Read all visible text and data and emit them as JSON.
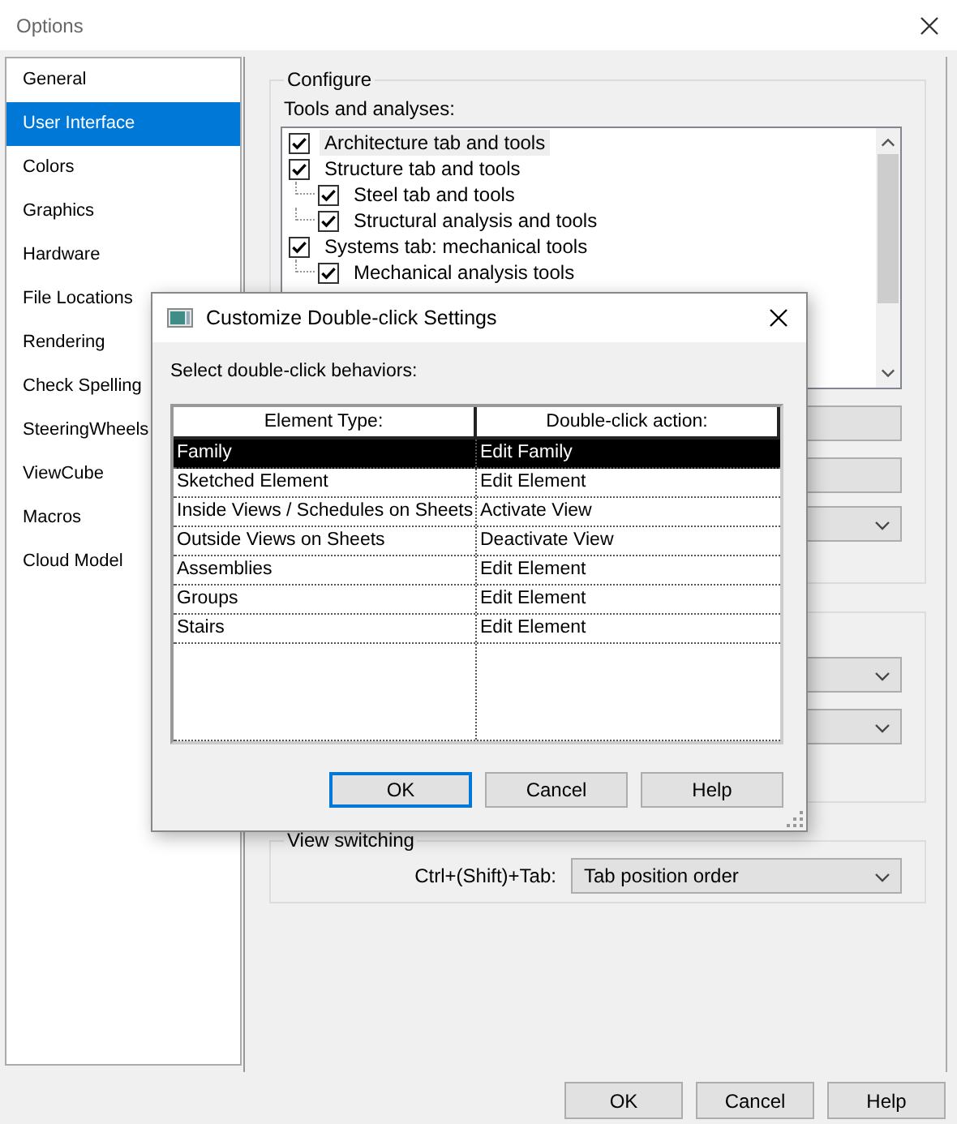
{
  "window": {
    "title": "Options"
  },
  "sidebar": {
    "items": [
      {
        "label": "General",
        "selected": false
      },
      {
        "label": "User Interface",
        "selected": true
      },
      {
        "label": "Colors",
        "selected": false
      },
      {
        "label": "Graphics",
        "selected": false
      },
      {
        "label": "Hardware",
        "selected": false
      },
      {
        "label": "File Locations",
        "selected": false
      },
      {
        "label": "Rendering",
        "selected": false
      },
      {
        "label": "Check Spelling",
        "selected": false
      },
      {
        "label": "SteeringWheels",
        "selected": false
      },
      {
        "label": "ViewCube",
        "selected": false
      },
      {
        "label": "Macros",
        "selected": false
      },
      {
        "label": "Cloud Model",
        "selected": false
      }
    ]
  },
  "configure": {
    "title": "Configure",
    "tools_label": "Tools and analyses:",
    "tools": [
      {
        "label": "Architecture tab and tools",
        "checked": true,
        "selected": true
      },
      {
        "label": "Structure tab and tools",
        "checked": true,
        "selected": false,
        "children": [
          {
            "label": "Steel tab and tools",
            "checked": true,
            "selected": false
          },
          {
            "label": "Structural analysis and tools",
            "checked": true,
            "selected": false
          }
        ]
      },
      {
        "label": "Systems tab: mechanical tools",
        "checked": true,
        "selected": false,
        "children": [
          {
            "label": "Mechanical analysis tools",
            "checked": true,
            "selected": false
          }
        ]
      }
    ]
  },
  "view_switching": {
    "title": "View switching",
    "label": "Ctrl+(Shift)+Tab:",
    "value": "Tab position order"
  },
  "buttons": [
    {
      "label": "OK"
    },
    {
      "label": "Cancel"
    },
    {
      "label": "Help"
    }
  ],
  "dialog": {
    "title": "Customize Double-click Settings",
    "prompt": "Select double-click behaviors:",
    "columns": [
      "Element Type:",
      "Double-click action:"
    ],
    "rows": [
      {
        "cells": [
          "Family",
          "Edit Family"
        ],
        "selected": true
      },
      {
        "cells": [
          "Sketched Element",
          "Edit Element"
        ],
        "selected": false
      },
      {
        "cells": [
          "Inside Views / Schedules on Sheets",
          "Activate View"
        ],
        "selected": false
      },
      {
        "cells": [
          "Outside Views on Sheets",
          "Deactivate View"
        ],
        "selected": false
      },
      {
        "cells": [
          "Assemblies",
          "Edit Element"
        ],
        "selected": false
      },
      {
        "cells": [
          "Groups",
          "Edit Element"
        ],
        "selected": false
      },
      {
        "cells": [
          "Stairs",
          "Edit Element"
        ],
        "selected": false
      }
    ],
    "buttons": [
      {
        "label": "OK",
        "default": true
      },
      {
        "label": "Cancel",
        "default": false
      },
      {
        "label": "Help",
        "default": false
      }
    ]
  }
}
